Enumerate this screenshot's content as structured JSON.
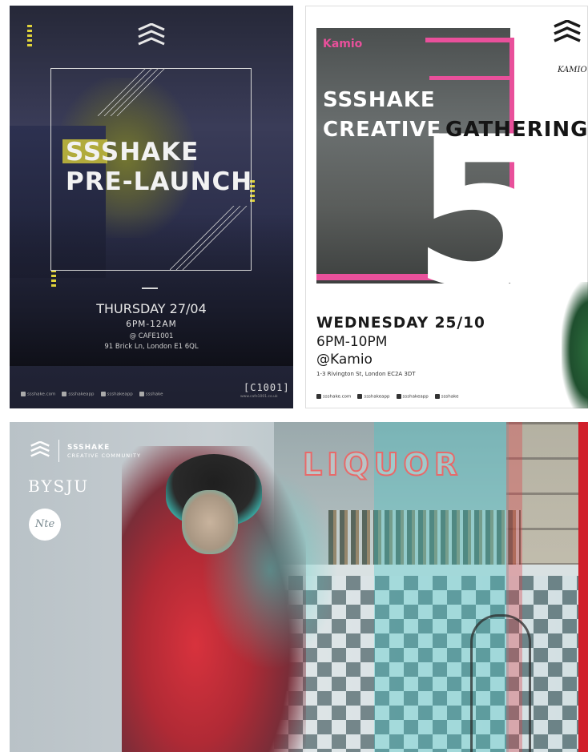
{
  "poster_pre_launch": {
    "title_line1": "SSSHAKE",
    "title_line2": "PRE-LAUNCH",
    "date": "THURSDAY 27/04",
    "time": "6PM-12AM",
    "venue": "@ CAFE1001",
    "address": "91 Brick Ln, London E1 6QL",
    "footer": [
      "ssshake.com",
      "ssshakeapp",
      "ssshakeapp",
      "ssshake"
    ],
    "partner_logo": "[C1001]",
    "partner_url": "www.cafe1001.co.uk",
    "colors": {
      "accent": "#e0d33a",
      "frame": "#d8d8d8"
    }
  },
  "poster_gathering": {
    "sign_text": "Kamio",
    "title_line1": "SSSHAKE",
    "title_line2a": "CREATIVE",
    "title_line2b": "GATHERING",
    "number": "5",
    "brand": "KAMIO",
    "date": "WEDNESDAY 25/10",
    "time": "6PM-10PM",
    "venue": "@Kamio",
    "address": "1-3 Rivington St, London EC2A 3DT",
    "footer": [
      "ssshake.com",
      "ssshakeapp",
      "ssshakeapp",
      "ssshake"
    ],
    "colors": {
      "accent": "#e9509b"
    }
  },
  "poster_community": {
    "brand_title": "SSSHAKE",
    "brand_sub": "CREATIVE COMMUNITY",
    "partner1": "BYSJU",
    "partner2": "Nte",
    "sign_text": "LIQUOR",
    "colors": {
      "red": "#d01f2a",
      "cyan": "#40c8c8"
    }
  }
}
